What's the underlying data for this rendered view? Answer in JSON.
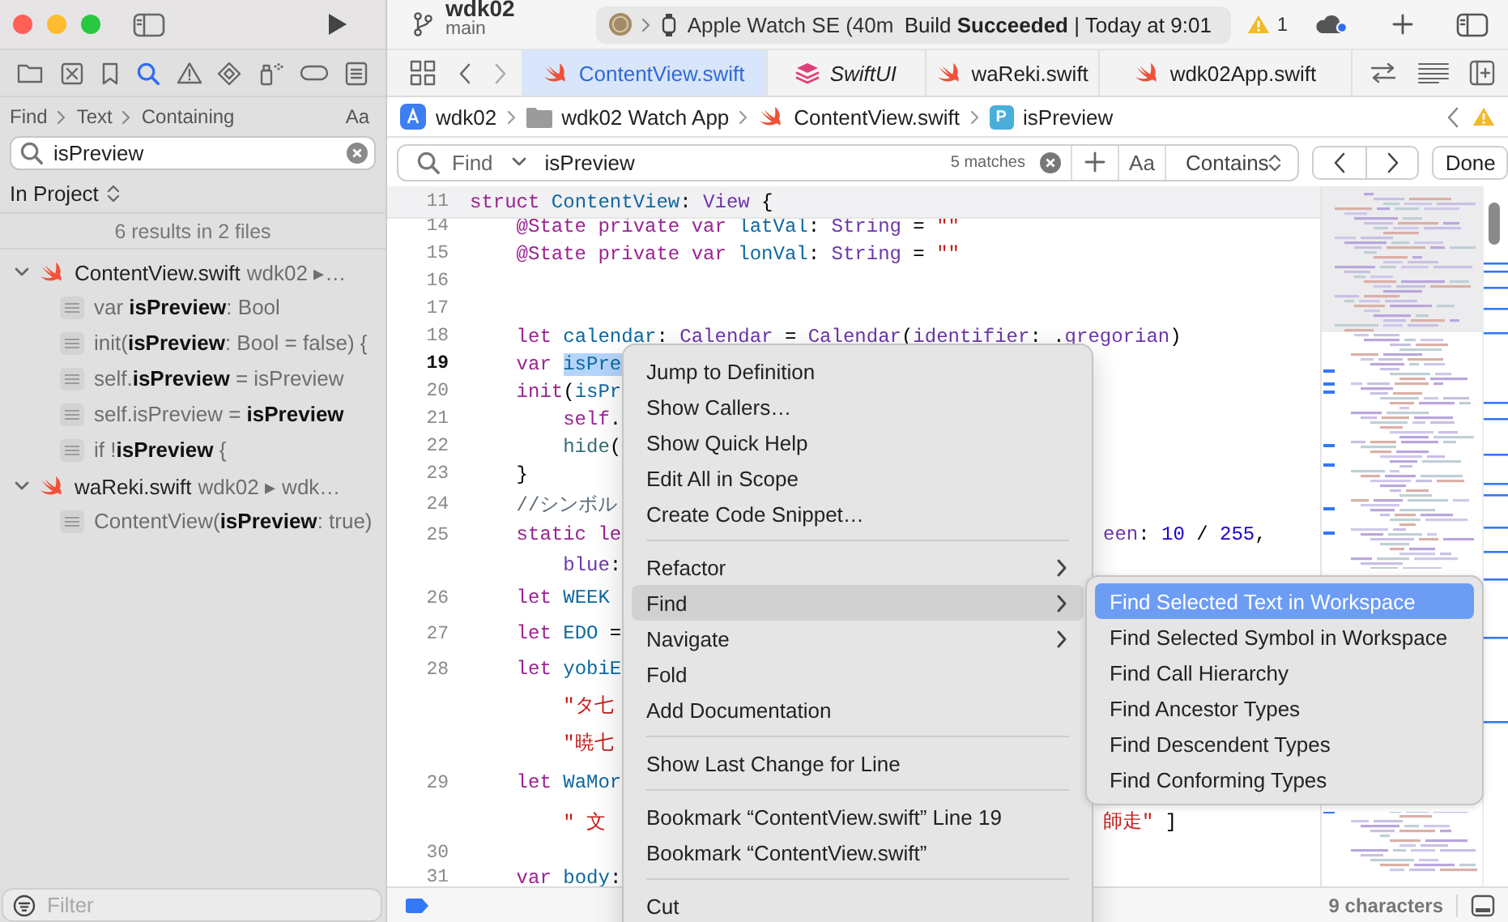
{
  "window": {
    "project": "wdk02",
    "branch": "main"
  },
  "navigator": {
    "tabs": [
      {
        "selected": false
      },
      {
        "selected": false
      },
      {
        "selected": false
      },
      {
        "selected": true
      },
      {
        "selected": false
      },
      {
        "selected": false
      },
      {
        "selected": false
      },
      {
        "selected": false
      },
      {
        "selected": false
      }
    ],
    "find_path": [
      "Find",
      "Text",
      "Containing"
    ],
    "case_toggle": "Aa",
    "query": "isPreview",
    "scope": "In Project",
    "summary": "6 results in 2 files",
    "files": [
      {
        "name": "ContentView.swift",
        "path": "wdk02 ▸…",
        "expanded": true,
        "children": [
          {
            "text": "var **isPreview**: Bool"
          },
          {
            "text": "init(**isPreview**: Bool = false) {"
          },
          {
            "text": "self.**isPreview** = isPreview"
          },
          {
            "text": "self.isPreview = **isPreview**"
          },
          {
            "text": "if !**isPreview** {"
          }
        ]
      },
      {
        "name": "waReki.swift",
        "path": "wdk02 ▸ wdk…",
        "expanded": true,
        "children": [
          {
            "text": "ContentView(**isPreview**: true)"
          }
        ]
      }
    ],
    "filter": {
      "placeholder": "Filter"
    }
  },
  "activity": {
    "device": "Apple Watch SE (40m",
    "status": "Build **Succeeded** | Today at 9:01",
    "warnings": "1"
  },
  "tabs": [
    {
      "label": "ContentView.swift",
      "kind": "swift",
      "selected": true,
      "preview": false
    },
    {
      "label": "SwiftUI",
      "kind": "module",
      "selected": false,
      "preview": true
    },
    {
      "label": "waReki.swift",
      "kind": "swift",
      "selected": false,
      "preview": false
    },
    {
      "label": "wdk02App.swift",
      "kind": "swift",
      "selected": false,
      "preview": false
    }
  ],
  "breadcrumb": [
    {
      "label": "wdk02",
      "kind": "app"
    },
    {
      "label": "wdk02 Watch App",
      "kind": "folder"
    },
    {
      "label": "ContentView.swift",
      "kind": "swift"
    },
    {
      "label": "isPreview",
      "kind": "property",
      "symbol": "P"
    }
  ],
  "find_bar": {
    "mode": "Find",
    "query": "isPreview",
    "matches": "5 matches",
    "case_toggle": "Aa",
    "match_type": "Contains",
    "done": "Done"
  },
  "editor": {
    "sticky": {
      "number": "11",
      "tokens": [
        {
          "text": "struct",
          "kind": "keyword"
        },
        {
          "text": " ContentView",
          "kind": "declaration"
        },
        {
          "text": ": ",
          "kind": "plain"
        },
        {
          "text": "View",
          "kind": "type"
        },
        {
          "text": " {",
          "kind": "plain"
        }
      ]
    },
    "lines": [
      {
        "number": "14",
        "current": false,
        "tokens": [
          {
            "text": "    @State",
            "kind": "keyword"
          },
          {
            "text": " private",
            "kind": "keyword"
          },
          {
            "text": " var",
            "kind": "keyword"
          },
          {
            "text": " latVal",
            "kind": "declaration"
          },
          {
            "text": ": ",
            "kind": "plain"
          },
          {
            "text": "String",
            "kind": "type"
          },
          {
            "text": " = ",
            "kind": "plain"
          },
          {
            "text": "\"\"",
            "kind": "string"
          }
        ]
      },
      {
        "number": "15",
        "current": false,
        "tokens": [
          {
            "text": "    @State",
            "kind": "keyword"
          },
          {
            "text": " private",
            "kind": "keyword"
          },
          {
            "text": " var",
            "kind": "keyword"
          },
          {
            "text": " lonVal",
            "kind": "declaration"
          },
          {
            "text": ": ",
            "kind": "plain"
          },
          {
            "text": "String",
            "kind": "type"
          },
          {
            "text": " = ",
            "kind": "plain"
          },
          {
            "text": "\"\"",
            "kind": "string"
          }
        ]
      },
      {
        "number": "16",
        "current": false
      },
      {
        "number": "17",
        "current": false
      },
      {
        "number": "18",
        "current": false,
        "tokens": [
          {
            "text": "    let",
            "kind": "keyword"
          },
          {
            "text": " calendar",
            "kind": "declaration"
          },
          {
            "text": ": ",
            "kind": "plain"
          },
          {
            "text": "Calendar",
            "kind": "type"
          },
          {
            "text": " = ",
            "kind": "plain"
          },
          {
            "text": "Calendar",
            "kind": "type"
          },
          {
            "text": "(",
            "kind": "plain"
          },
          {
            "text": "identifier",
            "kind": "type"
          },
          {
            "text": ": .",
            "kind": "plain"
          },
          {
            "text": "gregorian",
            "kind": "type"
          },
          {
            "text": ")",
            "kind": "plain"
          }
        ]
      },
      {
        "number": "19",
        "current": true,
        "tokens": [
          {
            "text": "    var ",
            "kind": "keyword"
          },
          {
            "text": "isPre",
            "kind": "selection"
          }
        ]
      },
      {
        "number": "20",
        "current": false,
        "tokens": [
          {
            "text": "    init",
            "kind": "keyword"
          },
          {
            "text": "(",
            "kind": "plain"
          },
          {
            "text": "isPr",
            "kind": "declaration"
          }
        ]
      },
      {
        "number": "21",
        "current": false,
        "tokens": [
          {
            "text": "        self",
            "kind": "keyword"
          },
          {
            "text": ".",
            "kind": "plain"
          }
        ]
      },
      {
        "number": "22",
        "current": false,
        "tokens": [
          {
            "text": "        hide",
            "kind": "call"
          },
          {
            "text": "(",
            "kind": "plain"
          }
        ]
      },
      {
        "number": "23",
        "current": false,
        "tokens": [
          {
            "text": "    }",
            "kind": "plain"
          }
        ]
      },
      {
        "number": "24",
        "current": false,
        "tokens": [
          {
            "text": "    //シンボル",
            "kind": "comment"
          }
        ]
      },
      {
        "number": "25",
        "current": false,
        "tokens": [
          {
            "text": "    static",
            "kind": "keyword"
          },
          {
            "text": " le",
            "kind": "keyword"
          }
        ],
        "after_menu": [
          {
            "text": "een",
            "kind": "type"
          },
          {
            "text": ": ",
            "kind": "plain"
          },
          {
            "text": "10",
            "kind": "number"
          },
          {
            "text": " / ",
            "kind": "plain"
          },
          {
            "text": "255",
            "kind": "number"
          },
          {
            "text": ",",
            "kind": "plain"
          }
        ]
      },
      {
        "tokens": [
          {
            "text": "        blue",
            "kind": "type"
          },
          {
            "text": ":",
            "kind": "plain"
          }
        ]
      },
      {
        "number": "26",
        "current": false,
        "tokens": [
          {
            "text": "    let",
            "kind": "keyword"
          },
          {
            "text": " WEEK",
            "kind": "declaration"
          }
        ]
      },
      {
        "number": "27",
        "current": false,
        "tokens": [
          {
            "text": "    let",
            "kind": "keyword"
          },
          {
            "text": " EDO",
            "kind": "declaration"
          },
          {
            "text": " =",
            "kind": "plain"
          }
        ]
      },
      {
        "number": "28",
        "current": false,
        "tokens": [
          {
            "text": "    let",
            "kind": "keyword"
          },
          {
            "text": " yobiE",
            "kind": "declaration"
          }
        ]
      },
      {
        "tokens": [
          {
            "text": "        \"タ七",
            "kind": "string"
          }
        ]
      },
      {
        "tokens": [
          {
            "text": "        \"暁七",
            "kind": "string"
          }
        ]
      },
      {
        "number": "29",
        "current": false,
        "tokens": [
          {
            "text": "    let",
            "kind": "keyword"
          },
          {
            "text": " WaMor",
            "kind": "declaration"
          }
        ]
      },
      {
        "tokens": [
          {
            "text": "        \" 文",
            "kind": "string"
          }
        ],
        "after_menu": [
          {
            "text": "師走\"",
            "kind": "string"
          },
          {
            "text": " ]",
            "kind": "plain"
          }
        ]
      },
      {
        "number": "30",
        "current": false
      },
      {
        "number": "31",
        "current": false,
        "tokens": [
          {
            "text": "    var",
            "kind": "keyword"
          },
          {
            "text": " body",
            "kind": "declaration"
          },
          {
            "text": ":",
            "kind": "plain"
          }
        ]
      }
    ]
  },
  "context_menu": {
    "items": [
      {
        "kind": "item",
        "label": "Jump to Definition",
        "selected": false
      },
      {
        "kind": "item",
        "label": "Show Callers…",
        "selected": false
      },
      {
        "kind": "item",
        "label": "Show Quick Help",
        "selected": false
      },
      {
        "kind": "item",
        "label": "Edit All in Scope",
        "selected": false
      },
      {
        "kind": "item",
        "label": "Create Code Snippet…",
        "selected": false
      },
      {
        "kind": "separator"
      },
      {
        "kind": "submenu",
        "label": "Refactor",
        "selected": false
      },
      {
        "kind": "submenu",
        "label": "Find",
        "selected": true
      },
      {
        "kind": "submenu",
        "label": "Navigate",
        "selected": false
      },
      {
        "kind": "item",
        "label": "Fold",
        "selected": false
      },
      {
        "kind": "item",
        "label": "Add Documentation",
        "selected": false
      },
      {
        "kind": "separator"
      },
      {
        "kind": "item",
        "label": "Show Last Change for Line",
        "selected": false
      },
      {
        "kind": "separator"
      },
      {
        "kind": "item",
        "label": "Bookmark “ContentView.swift” Line 19",
        "selected": false
      },
      {
        "kind": "item",
        "label": "Bookmark “ContentView.swift”",
        "selected": false
      },
      {
        "kind": "separator"
      },
      {
        "kind": "item",
        "label": "Cut",
        "selected": false
      }
    ],
    "submenu": [
      {
        "label": "Find Selected Text in Workspace",
        "selected": true
      },
      {
        "label": "Find Selected Symbol in Workspace",
        "selected": false
      },
      {
        "label": "Find Call Hierarchy",
        "selected": false
      },
      {
        "label": "Find Ancestor Types",
        "selected": false
      },
      {
        "label": "Find Descendent Types",
        "selected": false
      },
      {
        "label": "Find Conforming Types",
        "selected": false
      }
    ]
  },
  "status_bar": {
    "selection": "9 characters"
  }
}
